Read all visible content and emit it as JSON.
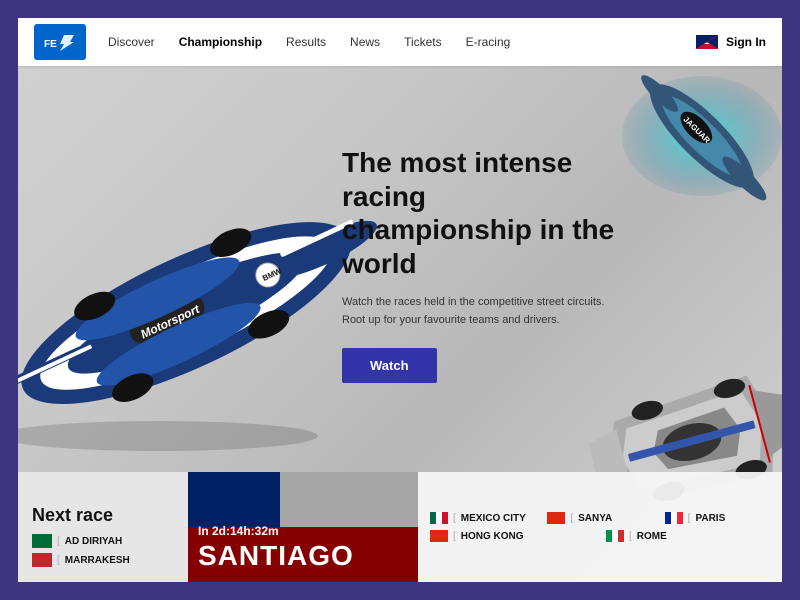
{
  "brand": {
    "logo_alt": "Formula E"
  },
  "nav": {
    "links": [
      {
        "label": "Discover",
        "active": false
      },
      {
        "label": "Championship",
        "active": true
      },
      {
        "label": "Results",
        "active": false
      },
      {
        "label": "News",
        "active": false
      },
      {
        "label": "Tickets",
        "active": false
      },
      {
        "label": "E-racing",
        "active": false
      }
    ],
    "sign_in": "Sign In"
  },
  "hero": {
    "title": "The most intense racing championship in the world",
    "description": "Watch the races held in the competitive street circuits. Root up for your favourite teams and drivers.",
    "cta_label": "Watch"
  },
  "next_race": {
    "section_title": "Next race",
    "featured_city": "SANTIAGO",
    "countdown": "In 2d:14h:32m",
    "races_left": [
      {
        "city": "AD DIRIYAH",
        "flag_class": "flag-saudi"
      },
      {
        "city": "MARRAKESH",
        "flag_class": "flag-morocco"
      }
    ],
    "races_right": [
      {
        "city": "MEXICO CITY",
        "flag_class": "flag-mexico"
      },
      {
        "city": "SANYA",
        "flag_class": "flag-china"
      },
      {
        "city": "PARIS",
        "flag_class": "flag-france"
      },
      {
        "city": "HONG KONG",
        "flag_class": "flag-hongkong"
      },
      {
        "city": "ROME",
        "flag_class": "flag-italy"
      }
    ]
  }
}
